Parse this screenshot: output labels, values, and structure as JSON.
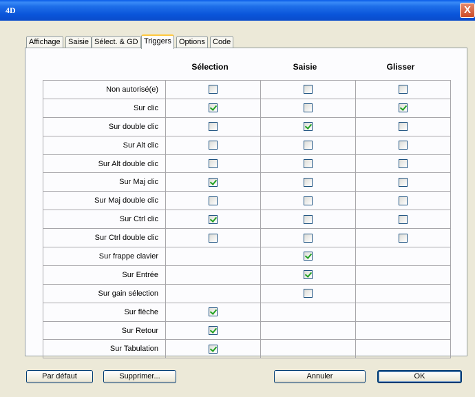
{
  "window": {
    "app_label": "4D",
    "close_label": "X"
  },
  "tabs": [
    {
      "label": "Affichage"
    },
    {
      "label": "Saisie"
    },
    {
      "label": "Sélect. & GD"
    },
    {
      "label": "Triggers",
      "active": true
    },
    {
      "label": "Options"
    },
    {
      "label": "Code"
    }
  ],
  "columns": [
    "Sélection",
    "Saisie",
    "Glisser"
  ],
  "rows": [
    {
      "label": "Non autorisé(e)",
      "cells": [
        false,
        false,
        false
      ]
    },
    {
      "label": "Sur clic",
      "cells": [
        true,
        false,
        true
      ]
    },
    {
      "label": "Sur double clic",
      "cells": [
        false,
        true,
        false
      ]
    },
    {
      "label": "Sur Alt clic",
      "cells": [
        false,
        false,
        false
      ]
    },
    {
      "label": "Sur Alt double clic",
      "cells": [
        false,
        false,
        false
      ]
    },
    {
      "label": "Sur Maj clic",
      "cells": [
        true,
        false,
        false
      ]
    },
    {
      "label": "Sur Maj double clic",
      "cells": [
        false,
        false,
        false
      ]
    },
    {
      "label": "Sur Ctrl clic",
      "cells": [
        true,
        false,
        false
      ]
    },
    {
      "label": "Sur Ctrl double clic",
      "cells": [
        false,
        false,
        false
      ]
    },
    {
      "label": "Sur frappe clavier",
      "cells": [
        null,
        true,
        null
      ]
    },
    {
      "label": "Sur Entrée",
      "cells": [
        null,
        true,
        null
      ]
    },
    {
      "label": "Sur gain sélection",
      "cells": [
        null,
        false,
        null
      ]
    },
    {
      "label": "Sur flèche",
      "cells": [
        true,
        null,
        null
      ]
    },
    {
      "label": "Sur Retour",
      "cells": [
        true,
        null,
        null
      ]
    },
    {
      "label": "Sur Tabulation",
      "cells": [
        true,
        null,
        null
      ]
    }
  ],
  "buttons": {
    "default_label": "Par défaut",
    "delete_label": "Supprimer...",
    "cancel_label": "Annuler",
    "ok_label": "OK"
  }
}
